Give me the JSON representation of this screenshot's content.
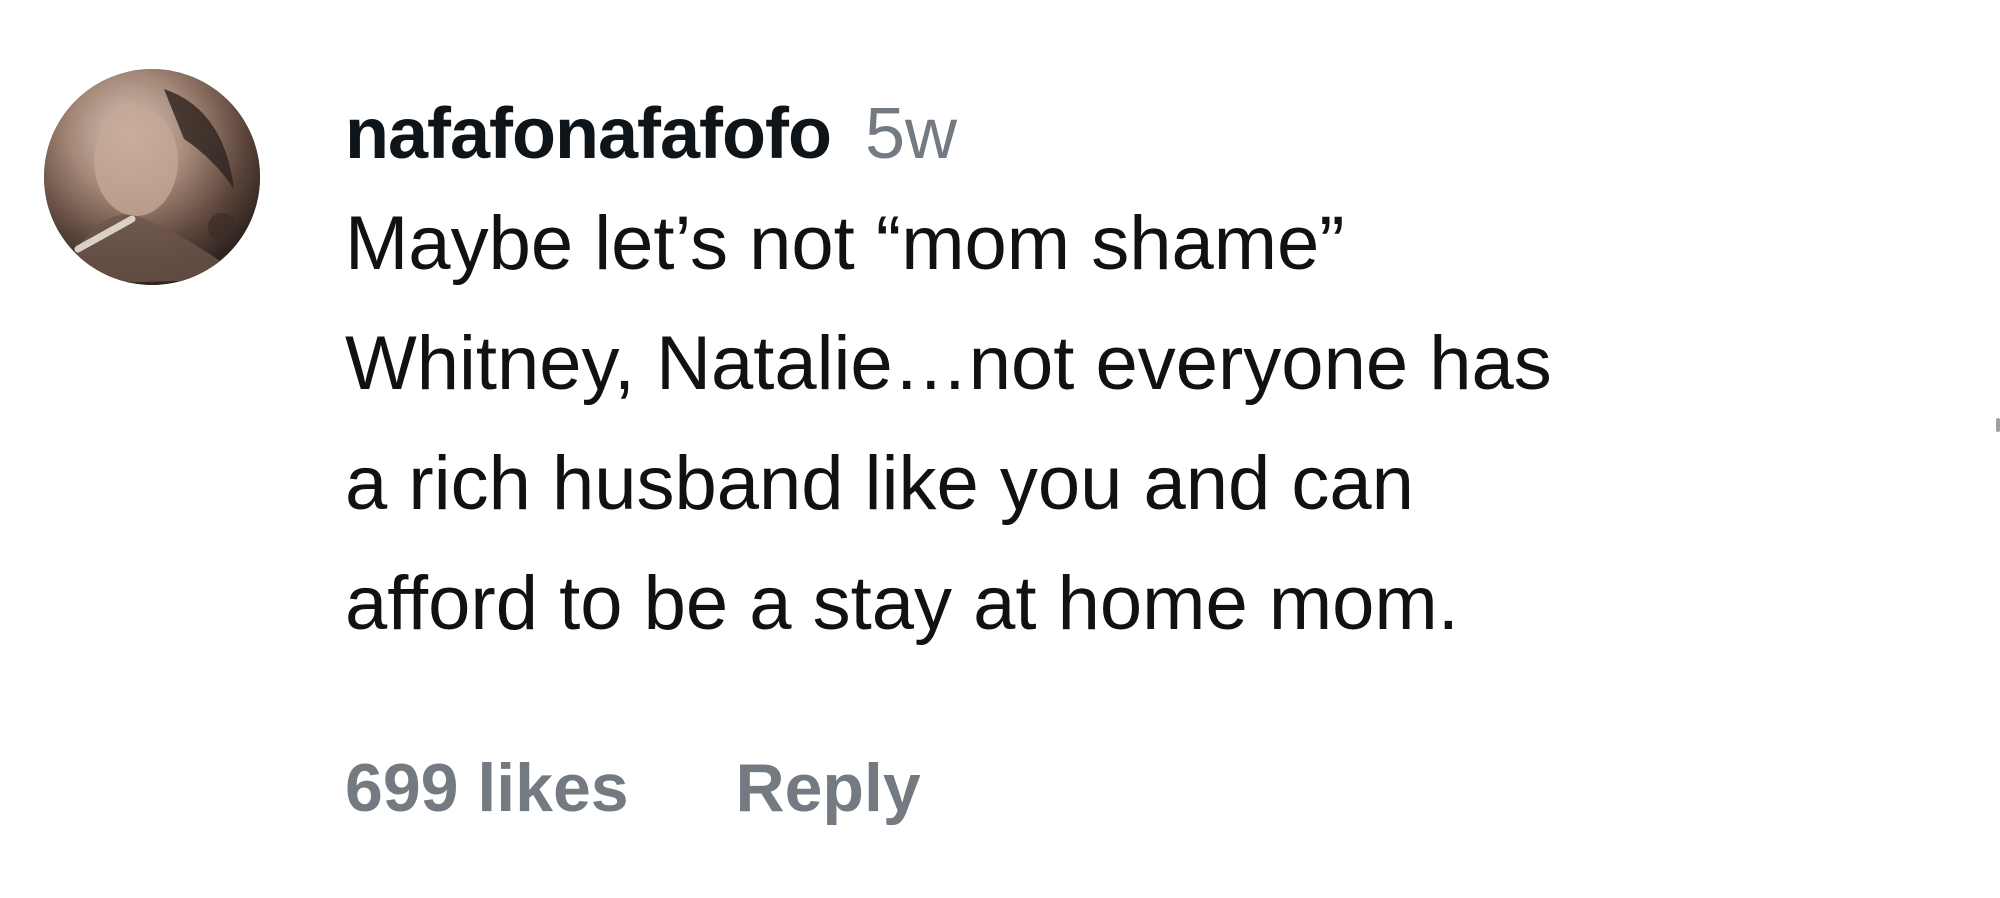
{
  "comment": {
    "username": "nafafonafafofo",
    "timestamp": "5w",
    "body_lines": [
      "Maybe let’s not “mom shame”",
      "Whitney, Natalie…not everyone has",
      "a rich husband like you and can",
      "afford to be a stay at home mom."
    ],
    "likes": "699 likes",
    "reply_label": "Reply"
  },
  "colors": {
    "text": "#0f1419",
    "muted": "#737a82",
    "background": "#ffffff"
  },
  "icons": {
    "avatar": "profile-photo"
  }
}
